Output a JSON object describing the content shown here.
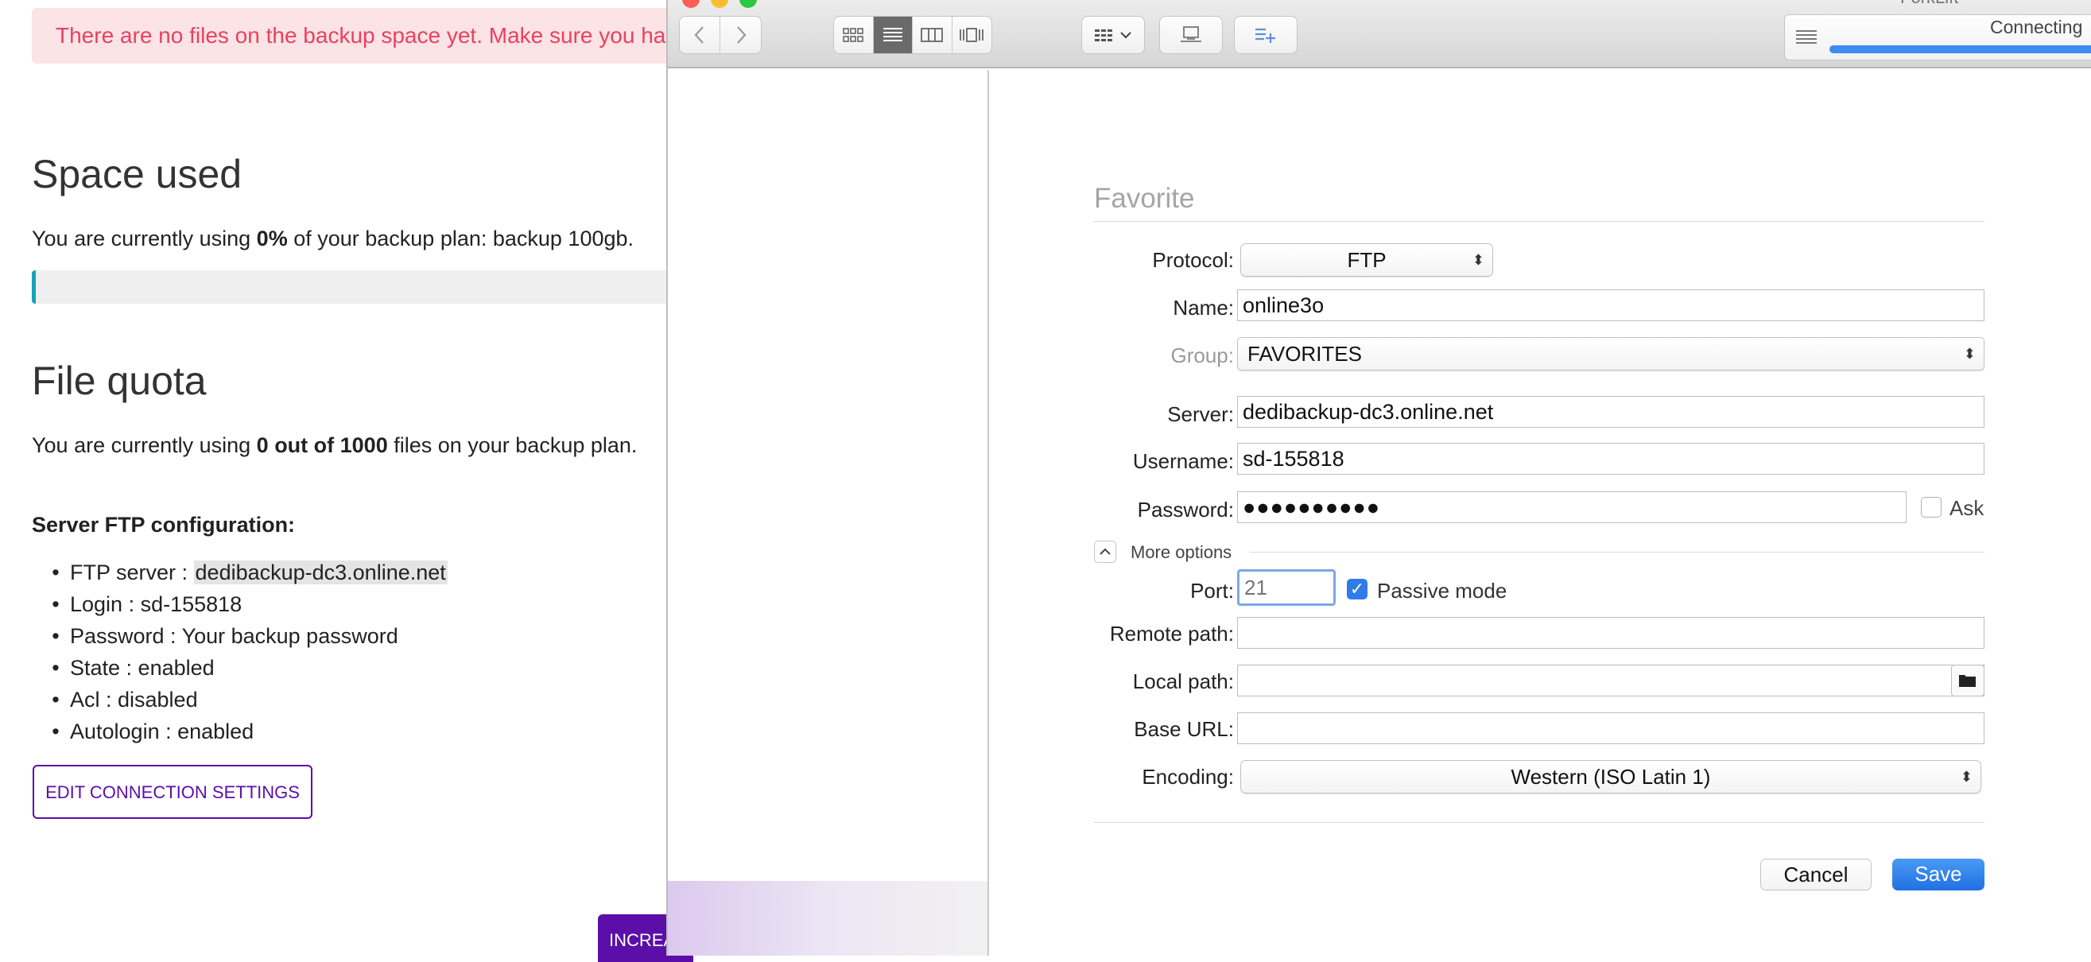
{
  "web": {
    "alert": "There are no files on the backup space yet. Make sure you have",
    "space_used": {
      "title": "Space used",
      "text_pre": "You are currently using ",
      "text_bold": "0%",
      "text_post": " of your backup plan: backup 100gb.",
      "progress_percent": 0
    },
    "file_quota": {
      "title": "File quota",
      "text_pre": "You are currently using ",
      "text_bold": "0 out of 1000",
      "text_post": " files on your backup plan."
    },
    "ftp": {
      "title": "Server FTP configuration:",
      "server_label": "FTP server : ",
      "server_value": "dedibackup-dc3.online.net",
      "items": [
        "Login : sd-155818",
        "Password : Your backup password",
        "State : enabled",
        "Acl : disabled",
        "Autologin : enabled"
      ]
    },
    "edit_button": "EDIT CONNECTION SETTINGS",
    "increase_button": "INCREA",
    "accent_color": "#5b0fa8",
    "alert_color": "#e8425f"
  },
  "window": {
    "app_title": "ForkLift",
    "status": "Connecting",
    "form": {
      "title": "Favorite",
      "protocol_label": "Protocol:",
      "protocol_value": "FTP",
      "name_label": "Name:",
      "name_value": "online3o",
      "group_label": "Group:",
      "group_value": "FAVORITES",
      "server_label": "Server:",
      "server_value": "dedibackup-dc3.online.net",
      "username_label": "Username:",
      "username_value": "sd-155818",
      "password_label": "Password:",
      "password_value": "●●●●●●●●●●",
      "ask_label": "Ask",
      "more_options": "More options",
      "port_label": "Port:",
      "port_placeholder": "21",
      "passive_label": "Passive mode",
      "passive_checked": true,
      "remote_path_label": "Remote path:",
      "remote_path_value": "",
      "local_path_label": "Local path:",
      "local_path_value": "",
      "base_url_label": "Base URL:",
      "base_url_value": "",
      "encoding_label": "Encoding:",
      "encoding_value": "Western (ISO Latin 1)",
      "cancel": "Cancel",
      "save": "Save"
    },
    "accent_color": "#2f7ce8"
  }
}
